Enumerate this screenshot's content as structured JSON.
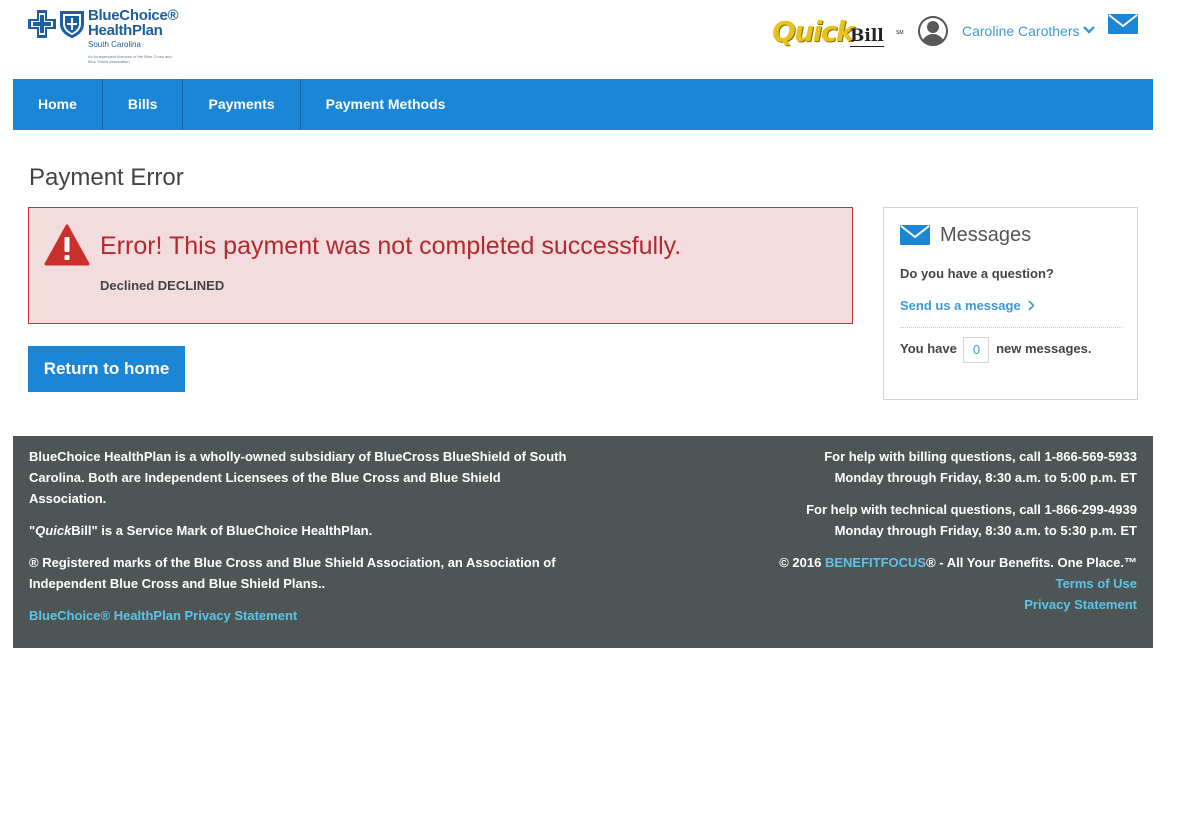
{
  "header": {
    "logo": {
      "name_line1": "BlueChoice®",
      "name_line2": "HealthPlan",
      "state": "South Carolina",
      "licensee_note": "An Independent licensee of the Blue Cross and Blue Shield Association"
    },
    "quickbill": {
      "quick": "Quick",
      "bill": "Bill",
      "sm": "SM"
    },
    "user": {
      "name": "Caroline Carothers"
    }
  },
  "nav": {
    "items": [
      {
        "label": "Home"
      },
      {
        "label": "Bills"
      },
      {
        "label": "Payments"
      },
      {
        "label": "Payment Methods"
      }
    ]
  },
  "main": {
    "page_title": "Payment Error",
    "error": {
      "title": "Error! This payment was not completed successfully.",
      "detail": "Declined DECLINED"
    },
    "return_button": "Return to home"
  },
  "messages": {
    "title": "Messages",
    "question": "Do you have a question?",
    "link": "Send us a message",
    "count_prefix": "You have",
    "count": "0",
    "count_suffix": "new messages."
  },
  "footer": {
    "left": {
      "subsidiary": "BlueChoice HealthPlan is a wholly-owned subsidiary of BlueCross BlueShield of South Carolina. Both are Independent Licensees of the Blue Cross and Blue Shield Association.",
      "service_mark_open": "\"",
      "service_mark_quick": "Quick",
      "service_mark_rest": "Bill\" is a Service Mark of BlueChoice HealthPlan.",
      "registered": "® Registered marks of the Blue Cross and Blue Shield Association, an Association of Independent Blue Cross and Blue Shield Plans..",
      "privacy_link": "BlueChoice® HealthPlan Privacy Statement"
    },
    "right": {
      "billing_line1": "For help with billing questions, call 1-866-569-5933",
      "billing_line2": "Monday through Friday, 8:30 a.m. to 5:00 p.m. ET",
      "tech_line1": "For help with technical questions, call 1-866-299-4939",
      "tech_line2": "Monday through Friday, 8:30 a.m. to 5:30 p.m. ET",
      "copyright_prefix": "© 2016",
      "benefitfocus": "BENEFITFOCUS",
      "copyright_suffix": "® - All Your Benefits. One Place.™",
      "terms_link": "Terms of Use",
      "privacy_link": "Privacy Statement"
    }
  }
}
